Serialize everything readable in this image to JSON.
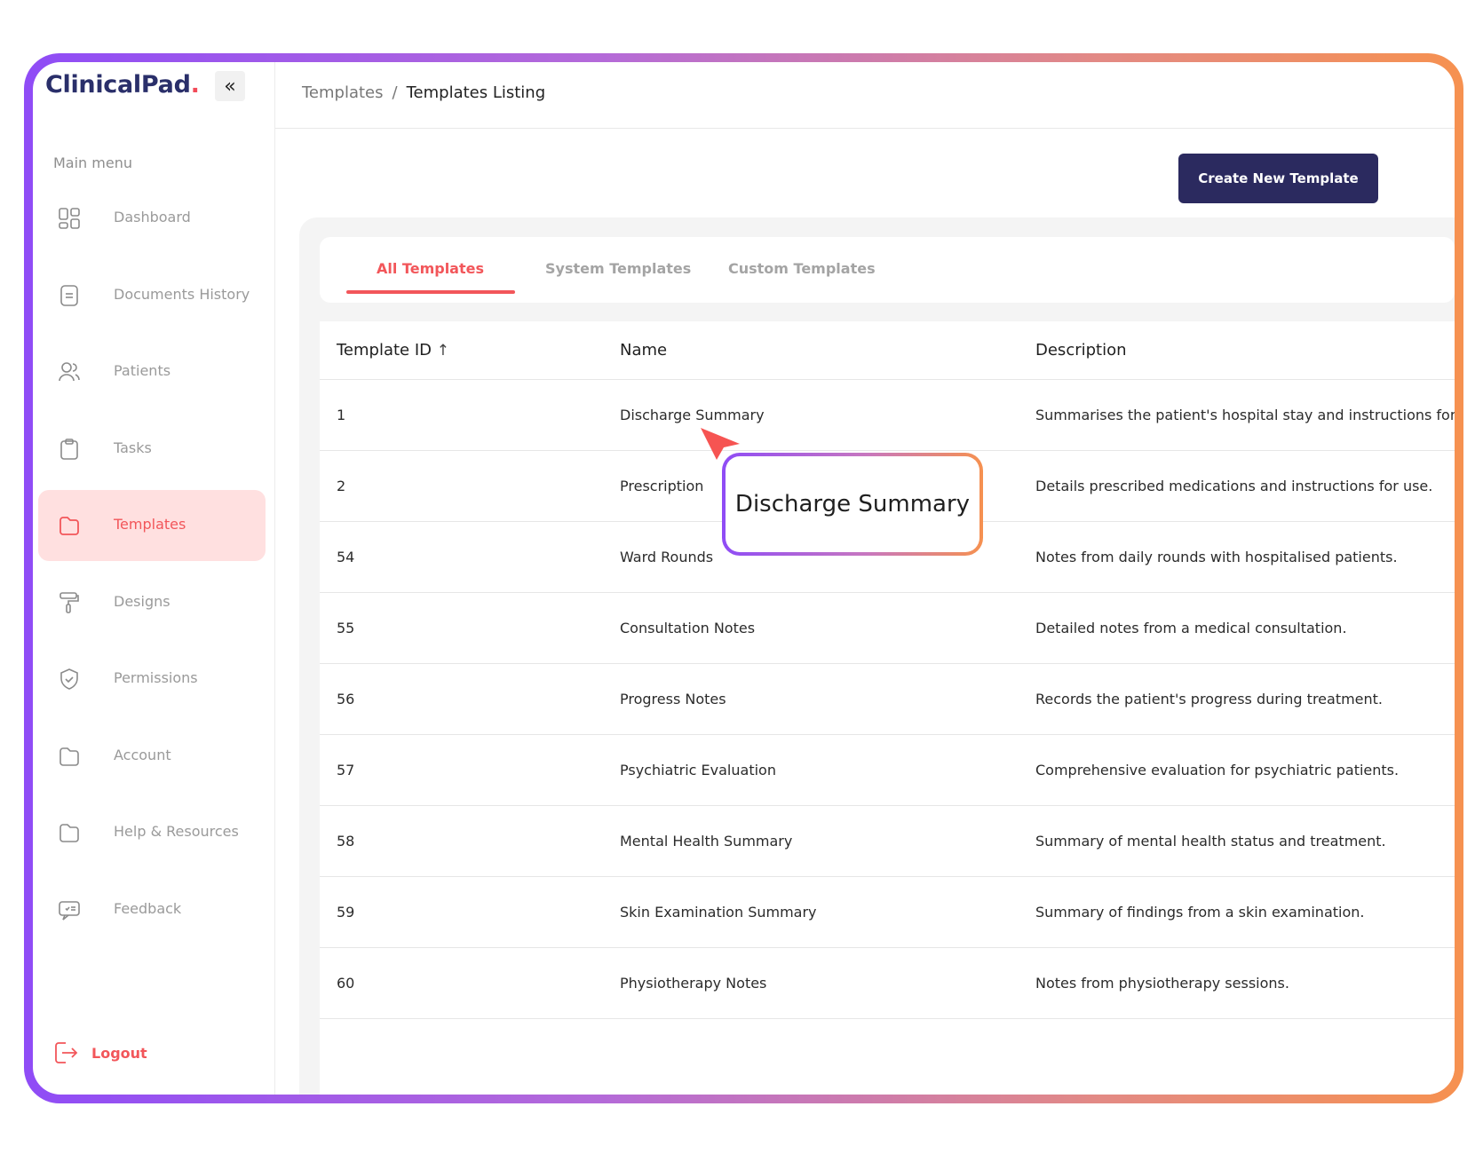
{
  "brand": {
    "name": "ClinicalPad",
    "dot": "."
  },
  "sidebar": {
    "collapse_icon": "«",
    "menu_title": "Main menu",
    "items": [
      {
        "label": "Dashboard",
        "icon": "grid-icon",
        "active": false
      },
      {
        "label": "Documents History",
        "icon": "document-icon",
        "active": false
      },
      {
        "label": "Patients",
        "icon": "users-icon",
        "active": false
      },
      {
        "label": "Tasks",
        "icon": "clipboard-icon",
        "active": false
      },
      {
        "label": "Templates",
        "icon": "folder-icon",
        "active": true
      },
      {
        "label": "Designs",
        "icon": "paint-roller-icon",
        "active": false
      },
      {
        "label": "Permissions",
        "icon": "shield-icon",
        "active": false
      },
      {
        "label": "Account",
        "icon": "folder-icon",
        "active": false
      },
      {
        "label": "Help & Resources",
        "icon": "folder-icon",
        "active": false
      },
      {
        "label": "Feedback",
        "icon": "chat-icon",
        "active": false
      }
    ],
    "logout_label": "Logout"
  },
  "breadcrumb": {
    "parent": "Templates",
    "separator": "/",
    "current": "Templates Listing"
  },
  "toolbar": {
    "create_label": "Create New Template"
  },
  "tabs": [
    "All Templates",
    "System Templates",
    "Custom Templates"
  ],
  "table": {
    "columns": [
      "Template ID",
      "Name",
      "Description"
    ],
    "sort_icon": "↑",
    "rows": [
      {
        "id": "1",
        "name": "Discharge Summary",
        "description": "Summarises the patient's hospital stay and instructions for dis"
      },
      {
        "id": "2",
        "name": "Prescription",
        "description": "Details prescribed medications and instructions for use."
      },
      {
        "id": "54",
        "name": "Ward Rounds",
        "description": "Notes from daily rounds with hospitalised patients."
      },
      {
        "id": "55",
        "name": "Consultation Notes",
        "description": "Detailed notes from a medical consultation."
      },
      {
        "id": "56",
        "name": "Progress Notes",
        "description": "Records the patient's progress during treatment."
      },
      {
        "id": "57",
        "name": "Psychiatric Evaluation",
        "description": "Comprehensive evaluation for psychiatric patients."
      },
      {
        "id": "58",
        "name": "Mental Health Summary",
        "description": "Summary of mental health status and treatment."
      },
      {
        "id": "59",
        "name": "Skin Examination Summary",
        "description": "Summary of findings from a skin examination."
      },
      {
        "id": "60",
        "name": "Physiotherapy Notes",
        "description": "Notes from physiotherapy sessions."
      }
    ]
  },
  "tooltip": {
    "text": "Discharge Summary"
  },
  "colors": {
    "accent": "#f2565a",
    "primary": "#2b2a5f",
    "active_bg": "#ffe0e0",
    "gradient_start": "#8f4cf6",
    "gradient_end": "#f69150"
  }
}
